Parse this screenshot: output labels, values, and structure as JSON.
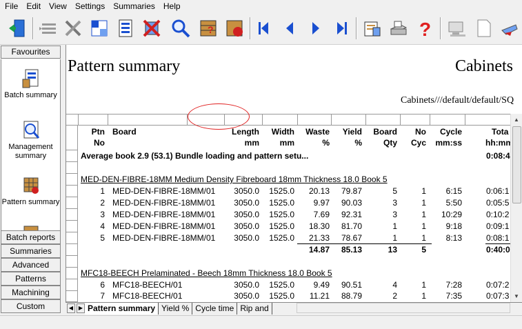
{
  "menu": [
    "File",
    "Edit",
    "View",
    "Settings",
    "Summaries",
    "Help"
  ],
  "toolbar_icons": [
    "exit-icon",
    "list-icon",
    "tools-icon",
    "pattern-icon",
    "batch-icon",
    "delete-icon",
    "search-icon",
    "report-icon",
    "run-icon",
    "first-icon",
    "previous-icon",
    "next-icon",
    "last-icon",
    "print-preview-icon",
    "print-icon",
    "help-icon",
    "computer-icon",
    "document-icon",
    "send-icon"
  ],
  "favourites": {
    "header": "Favourites",
    "items": [
      {
        "label": "Batch summary",
        "icon": "batch-summary-icon"
      },
      {
        "label": "Management summary",
        "icon": "management-summary-icon"
      },
      {
        "label": "Pattern summary",
        "icon": "pattern-summary-icon"
      }
    ]
  },
  "categories": [
    "Batch reports",
    "Summaries",
    "Advanced",
    "Patterns",
    "Machining",
    "Custom"
  ],
  "document": {
    "title": "Pattern summary",
    "title_right": "Cabinets",
    "path": "Cabinets///default/default/SQ",
    "headers_line1": {
      "ptn": "Ptn",
      "board": "Board",
      "length": "Length",
      "width": "Width",
      "waste": "Waste",
      "yield": "Yield",
      "board_qty": "Board",
      "no_cyc": "No",
      "cycle": "Cycle",
      "total": "Tota"
    },
    "headers_line2": {
      "ptn": "No",
      "length": "mm",
      "width": "mm",
      "waste": "%",
      "yield": "%",
      "board_qty": "Qty",
      "no_cyc": "Cyc",
      "cycle": "mm:ss",
      "total": "hh:mm:s"
    },
    "average_line": "Average book 2.9 (53.1) Bundle loading and pattern setu...",
    "average_total": "0:08:4",
    "groups": [
      {
        "title": "MED-DEN-FIBRE-18MM Medium Density Fibreboard 18mm Thickness  18.0 Book 5",
        "rows": [
          {
            "no": "1",
            "board": "MED-DEN-FIBRE-18MM/01",
            "length": "3050.0",
            "width": "1525.0",
            "waste": "20.13",
            "yield": "79.87",
            "qty": "5",
            "cyc": "1",
            "cycle": "6:15",
            "total": "0:06:1"
          },
          {
            "no": "2",
            "board": "MED-DEN-FIBRE-18MM/01",
            "length": "3050.0",
            "width": "1525.0",
            "waste": "9.97",
            "yield": "90.03",
            "qty": "3",
            "cyc": "1",
            "cycle": "5:50",
            "total": "0:05:5"
          },
          {
            "no": "3",
            "board": "MED-DEN-FIBRE-18MM/01",
            "length": "3050.0",
            "width": "1525.0",
            "waste": "7.69",
            "yield": "92.31",
            "qty": "3",
            "cyc": "1",
            "cycle": "10:29",
            "total": "0:10:2"
          },
          {
            "no": "4",
            "board": "MED-DEN-FIBRE-18MM/01",
            "length": "3050.0",
            "width": "1525.0",
            "waste": "18.30",
            "yield": "81.70",
            "qty": "1",
            "cyc": "1",
            "cycle": "9:18",
            "total": "0:09:1"
          },
          {
            "no": "5",
            "board": "MED-DEN-FIBRE-18MM/01",
            "length": "3050.0",
            "width": "1525.0",
            "waste": "21.33",
            "yield": "78.67",
            "qty": "1",
            "cyc": "1",
            "cycle": "8:13",
            "total": "0:08:1"
          }
        ],
        "totals": {
          "waste": "14.87",
          "yield": "85.13",
          "qty": "13",
          "cyc": "5",
          "total": "0:40:0"
        }
      },
      {
        "title": "MFC18-BEECH Prelaminated - Beech 18mm Thickness  18.0 Book 5",
        "rows": [
          {
            "no": "6",
            "board": "MFC18-BEECH/01",
            "length": "3050.0",
            "width": "1525.0",
            "waste": "9.49",
            "yield": "90.51",
            "qty": "4",
            "cyc": "1",
            "cycle": "7:28",
            "total": "0:07:2"
          },
          {
            "no": "7",
            "board": "MFC18-BEECH/01",
            "length": "3050.0",
            "width": "1525.0",
            "waste": "11.21",
            "yield": "88.79",
            "qty": "2",
            "cyc": "1",
            "cycle": "7:35",
            "total": "0:07:3"
          }
        ]
      }
    ]
  },
  "tabs": [
    "Pattern summary",
    "Yield %",
    "Cycle time",
    "Rip and"
  ],
  "colors": {
    "annotation": "#e02020",
    "toolbar_blue": "#1a4fd0"
  }
}
